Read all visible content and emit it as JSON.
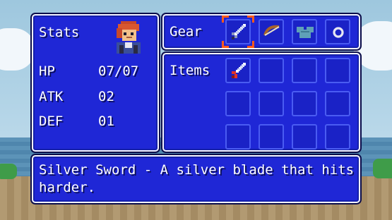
{
  "stats": {
    "title": "Stats",
    "rows": [
      {
        "label": "HP",
        "value": "07/07"
      },
      {
        "label": "ATK",
        "value": "02"
      },
      {
        "label": "DEF",
        "value": "01"
      }
    ]
  },
  "gear": {
    "title": "Gear",
    "slots": [
      {
        "icon": "sword-icon",
        "selected": true
      },
      {
        "icon": "bow-icon",
        "selected": false
      },
      {
        "icon": "armor-icon",
        "selected": false
      },
      {
        "icon": "ring-icon",
        "selected": false
      }
    ]
  },
  "items": {
    "title": "Items",
    "slots": [
      "red-sword-icon",
      "",
      "",
      "",
      "",
      "",
      "",
      "",
      "",
      "",
      "",
      ""
    ]
  },
  "description": {
    "text": "Silver Sword - A silver blade that hits harder."
  },
  "colors": {
    "panel": "#1f27d6",
    "border": "#f4f4ff",
    "cursor": "#ff5a1a"
  }
}
